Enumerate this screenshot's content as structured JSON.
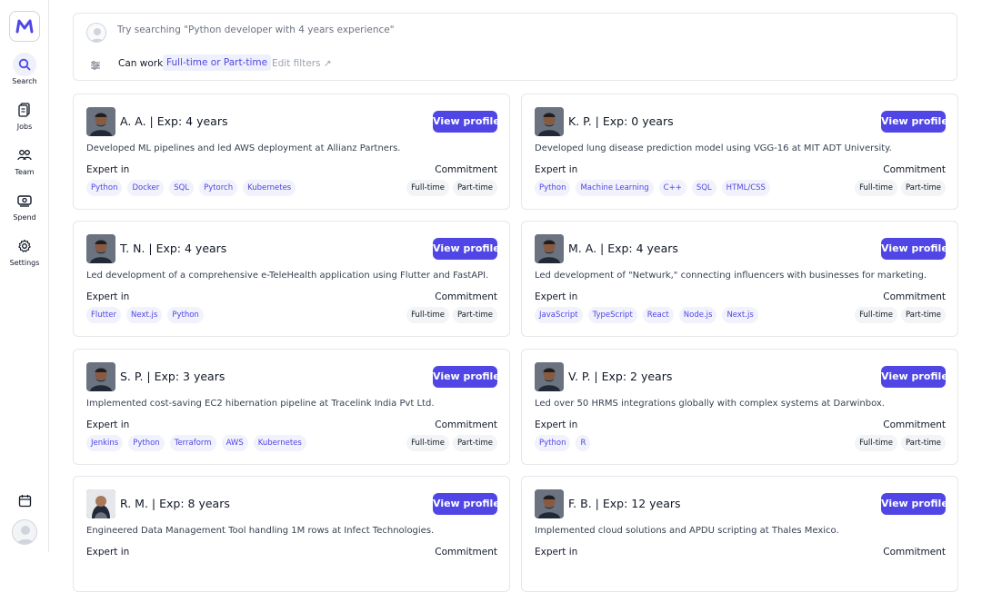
{
  "sidebar": {
    "logo": "M",
    "items": [
      {
        "label": "Search",
        "icon": "search-icon"
      },
      {
        "label": "Jobs",
        "icon": "jobs-icon"
      },
      {
        "label": "Team",
        "icon": "team-icon"
      },
      {
        "label": "Spend",
        "icon": "spend-icon"
      },
      {
        "label": "Settings",
        "icon": "gear-icon"
      }
    ]
  },
  "search": {
    "placeholder": "Try searching \"Python developer with 4 years experience\"",
    "filter_label": "Can work",
    "filter_value": "Full-time or Part-time",
    "edit_filters": "Edit filters ↗"
  },
  "colors": {
    "accent": "#4f46e5",
    "chip_bg": "#f1f2fb"
  },
  "candidates": [
    {
      "name": "A. A. | Exp: 4 years",
      "desc": "Developed ML pipelines and led AWS deployment at Allianz Partners.",
      "skills": [
        "Python",
        "Docker",
        "SQL",
        "Pytorch",
        "Kubernetes"
      ],
      "commitment": [
        "Full-time",
        "Part-time"
      ],
      "view": "View profile",
      "expert": "Expert in",
      "commit_label": "Commitment"
    },
    {
      "name": "K. P. | Exp: 0 years",
      "desc": "Developed lung disease prediction model using VGG-16 at MIT ADT University.",
      "skills": [
        "Python",
        "Machine Learning",
        "C++",
        "SQL",
        "HTML/CSS"
      ],
      "commitment": [
        "Full-time",
        "Part-time"
      ],
      "view": "View profile",
      "expert": "Expert in",
      "commit_label": "Commitment"
    },
    {
      "name": "T. N. | Exp: 4 years",
      "desc": "Led development of a comprehensive e-TeleHealth application using Flutter and FastAPI.",
      "skills": [
        "Flutter",
        "Next.js",
        "Python"
      ],
      "commitment": [
        "Full-time",
        "Part-time"
      ],
      "view": "View profile",
      "expert": "Expert in",
      "commit_label": "Commitment"
    },
    {
      "name": "M. A. | Exp: 4 years",
      "desc": "Led development of \"Netwurk,\" connecting influencers with businesses for marketing.",
      "skills": [
        "JavaScript",
        "TypeScript",
        "React",
        "Node.js",
        "Next.js"
      ],
      "commitment": [
        "Full-time",
        "Part-time"
      ],
      "view": "View profile",
      "expert": "Expert in",
      "commit_label": "Commitment"
    },
    {
      "name": "S. P. | Exp: 3 years",
      "desc": "Implemented cost-saving EC2 hibernation pipeline at Tracelink India Pvt Ltd.",
      "skills": [
        "Jenkins",
        "Python",
        "Terraform",
        "AWS",
        "Kubernetes"
      ],
      "commitment": [
        "Full-time",
        "Part-time"
      ],
      "view": "View profile",
      "expert": "Expert in",
      "commit_label": "Commitment"
    },
    {
      "name": "V. P. | Exp: 2 years",
      "desc": "Led over 50 HRMS integrations globally with complex systems at Darwinbox.",
      "skills": [
        "Python",
        "R"
      ],
      "commitment": [
        "Full-time",
        "Part-time"
      ],
      "view": "View profile",
      "expert": "Expert in",
      "commit_label": "Commitment"
    },
    {
      "name": "R. M. | Exp: 8 years",
      "desc": "Engineered Data Management Tool handling 1M rows at Infect Technologies.",
      "skills": [],
      "commitment": [],
      "view": "View profile",
      "expert": "Expert in",
      "commit_label": "Commitment"
    },
    {
      "name": "F. B. | Exp: 12 years",
      "desc": "Implemented cloud solutions and APDU scripting at Thales Mexico.",
      "skills": [],
      "commitment": [],
      "view": "View profile",
      "expert": "Expert in",
      "commit_label": "Commitment"
    }
  ]
}
